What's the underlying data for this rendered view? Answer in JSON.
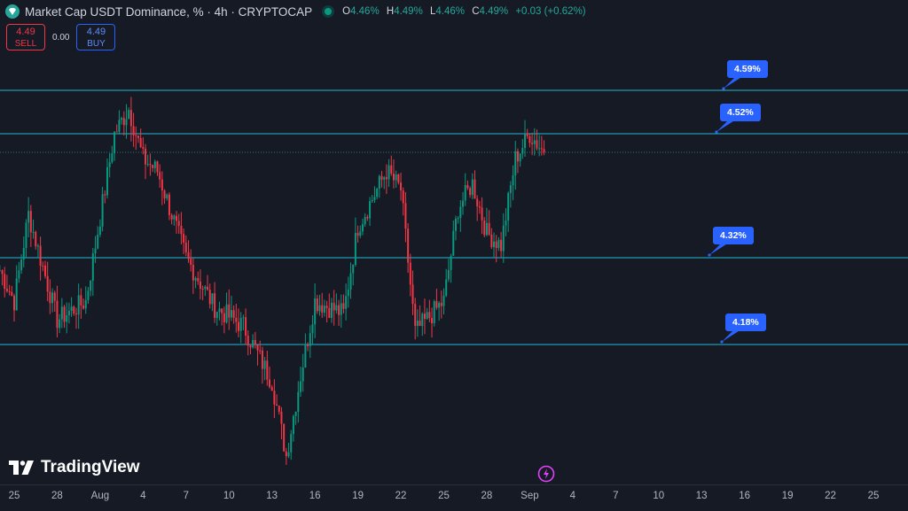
{
  "header": {
    "title": "Market Cap USDT Dominance, % · 4h · CRYPTOCAP",
    "ohlc": {
      "o_label": "O",
      "o": "4.46%",
      "h_label": "H",
      "h": "4.49%",
      "l_label": "L",
      "l": "4.46%",
      "c_label": "C",
      "c": "4.49%",
      "change": "+0.03 (+0.62%)"
    },
    "status_color": "#089981"
  },
  "trade": {
    "sell_price": "4.49",
    "sell_label": "SELL",
    "spread": "0.00",
    "buy_price": "4.49",
    "buy_label": "BUY"
  },
  "levels": [
    "4.59%",
    "4.52%",
    "4.32%",
    "4.18%"
  ],
  "x_axis": [
    "25",
    "28",
    "Aug",
    "4",
    "7",
    "10",
    "13",
    "16",
    "19",
    "22",
    "25",
    "28",
    "Sep",
    "4",
    "7",
    "10",
    "13",
    "16",
    "19",
    "22",
    "25"
  ],
  "logo": "TradingView",
  "colors": {
    "up": "#089981",
    "down": "#f23645",
    "level_line": "#22b8d1",
    "bubble": "#2962ff",
    "background": "#161a25"
  },
  "chart_data": {
    "type": "candlestick",
    "symbol": "Market Cap USDT Dominance, %",
    "timeframe": "4h",
    "horizontal_levels": [
      4.59,
      4.52,
      4.32,
      4.18
    ],
    "close_path": [
      {
        "date": "Jul 24",
        "close": 4.3
      },
      {
        "date": "Jul 25",
        "close": 4.25
      },
      {
        "date": "Jul 26",
        "close": 4.39
      },
      {
        "date": "Jul 28",
        "close": 4.22
      },
      {
        "date": "Jul 30",
        "close": 4.25
      },
      {
        "date": "Aug 1",
        "close": 4.52
      },
      {
        "date": "Aug 2",
        "close": 4.56
      },
      {
        "date": "Aug 3",
        "close": 4.48
      },
      {
        "date": "Aug 4",
        "close": 4.46
      },
      {
        "date": "Aug 6",
        "close": 4.32
      },
      {
        "date": "Aug 8",
        "close": 4.24
      },
      {
        "date": "Aug 10",
        "close": 4.21
      },
      {
        "date": "Aug 12",
        "close": 4.12
      },
      {
        "date": "Aug 13",
        "close": 4.0
      },
      {
        "date": "Aug 14",
        "close": 4.13
      },
      {
        "date": "Aug 15",
        "close": 4.25
      },
      {
        "date": "Aug 17",
        "close": 4.23
      },
      {
        "date": "Aug 18",
        "close": 4.37
      },
      {
        "date": "Aug 20",
        "close": 4.46
      },
      {
        "date": "Aug 21",
        "close": 4.43
      },
      {
        "date": "Aug 22",
        "close": 4.2
      },
      {
        "date": "Aug 24",
        "close": 4.25
      },
      {
        "date": "Aug 25",
        "close": 4.4
      },
      {
        "date": "Aug 26",
        "close": 4.44
      },
      {
        "date": "Aug 27",
        "close": 4.36
      },
      {
        "date": "Aug 28",
        "close": 4.34
      },
      {
        "date": "Aug 29",
        "close": 4.48
      },
      {
        "date": "Aug 30",
        "close": 4.52
      },
      {
        "date": "Aug 31",
        "close": 4.49
      }
    ]
  }
}
